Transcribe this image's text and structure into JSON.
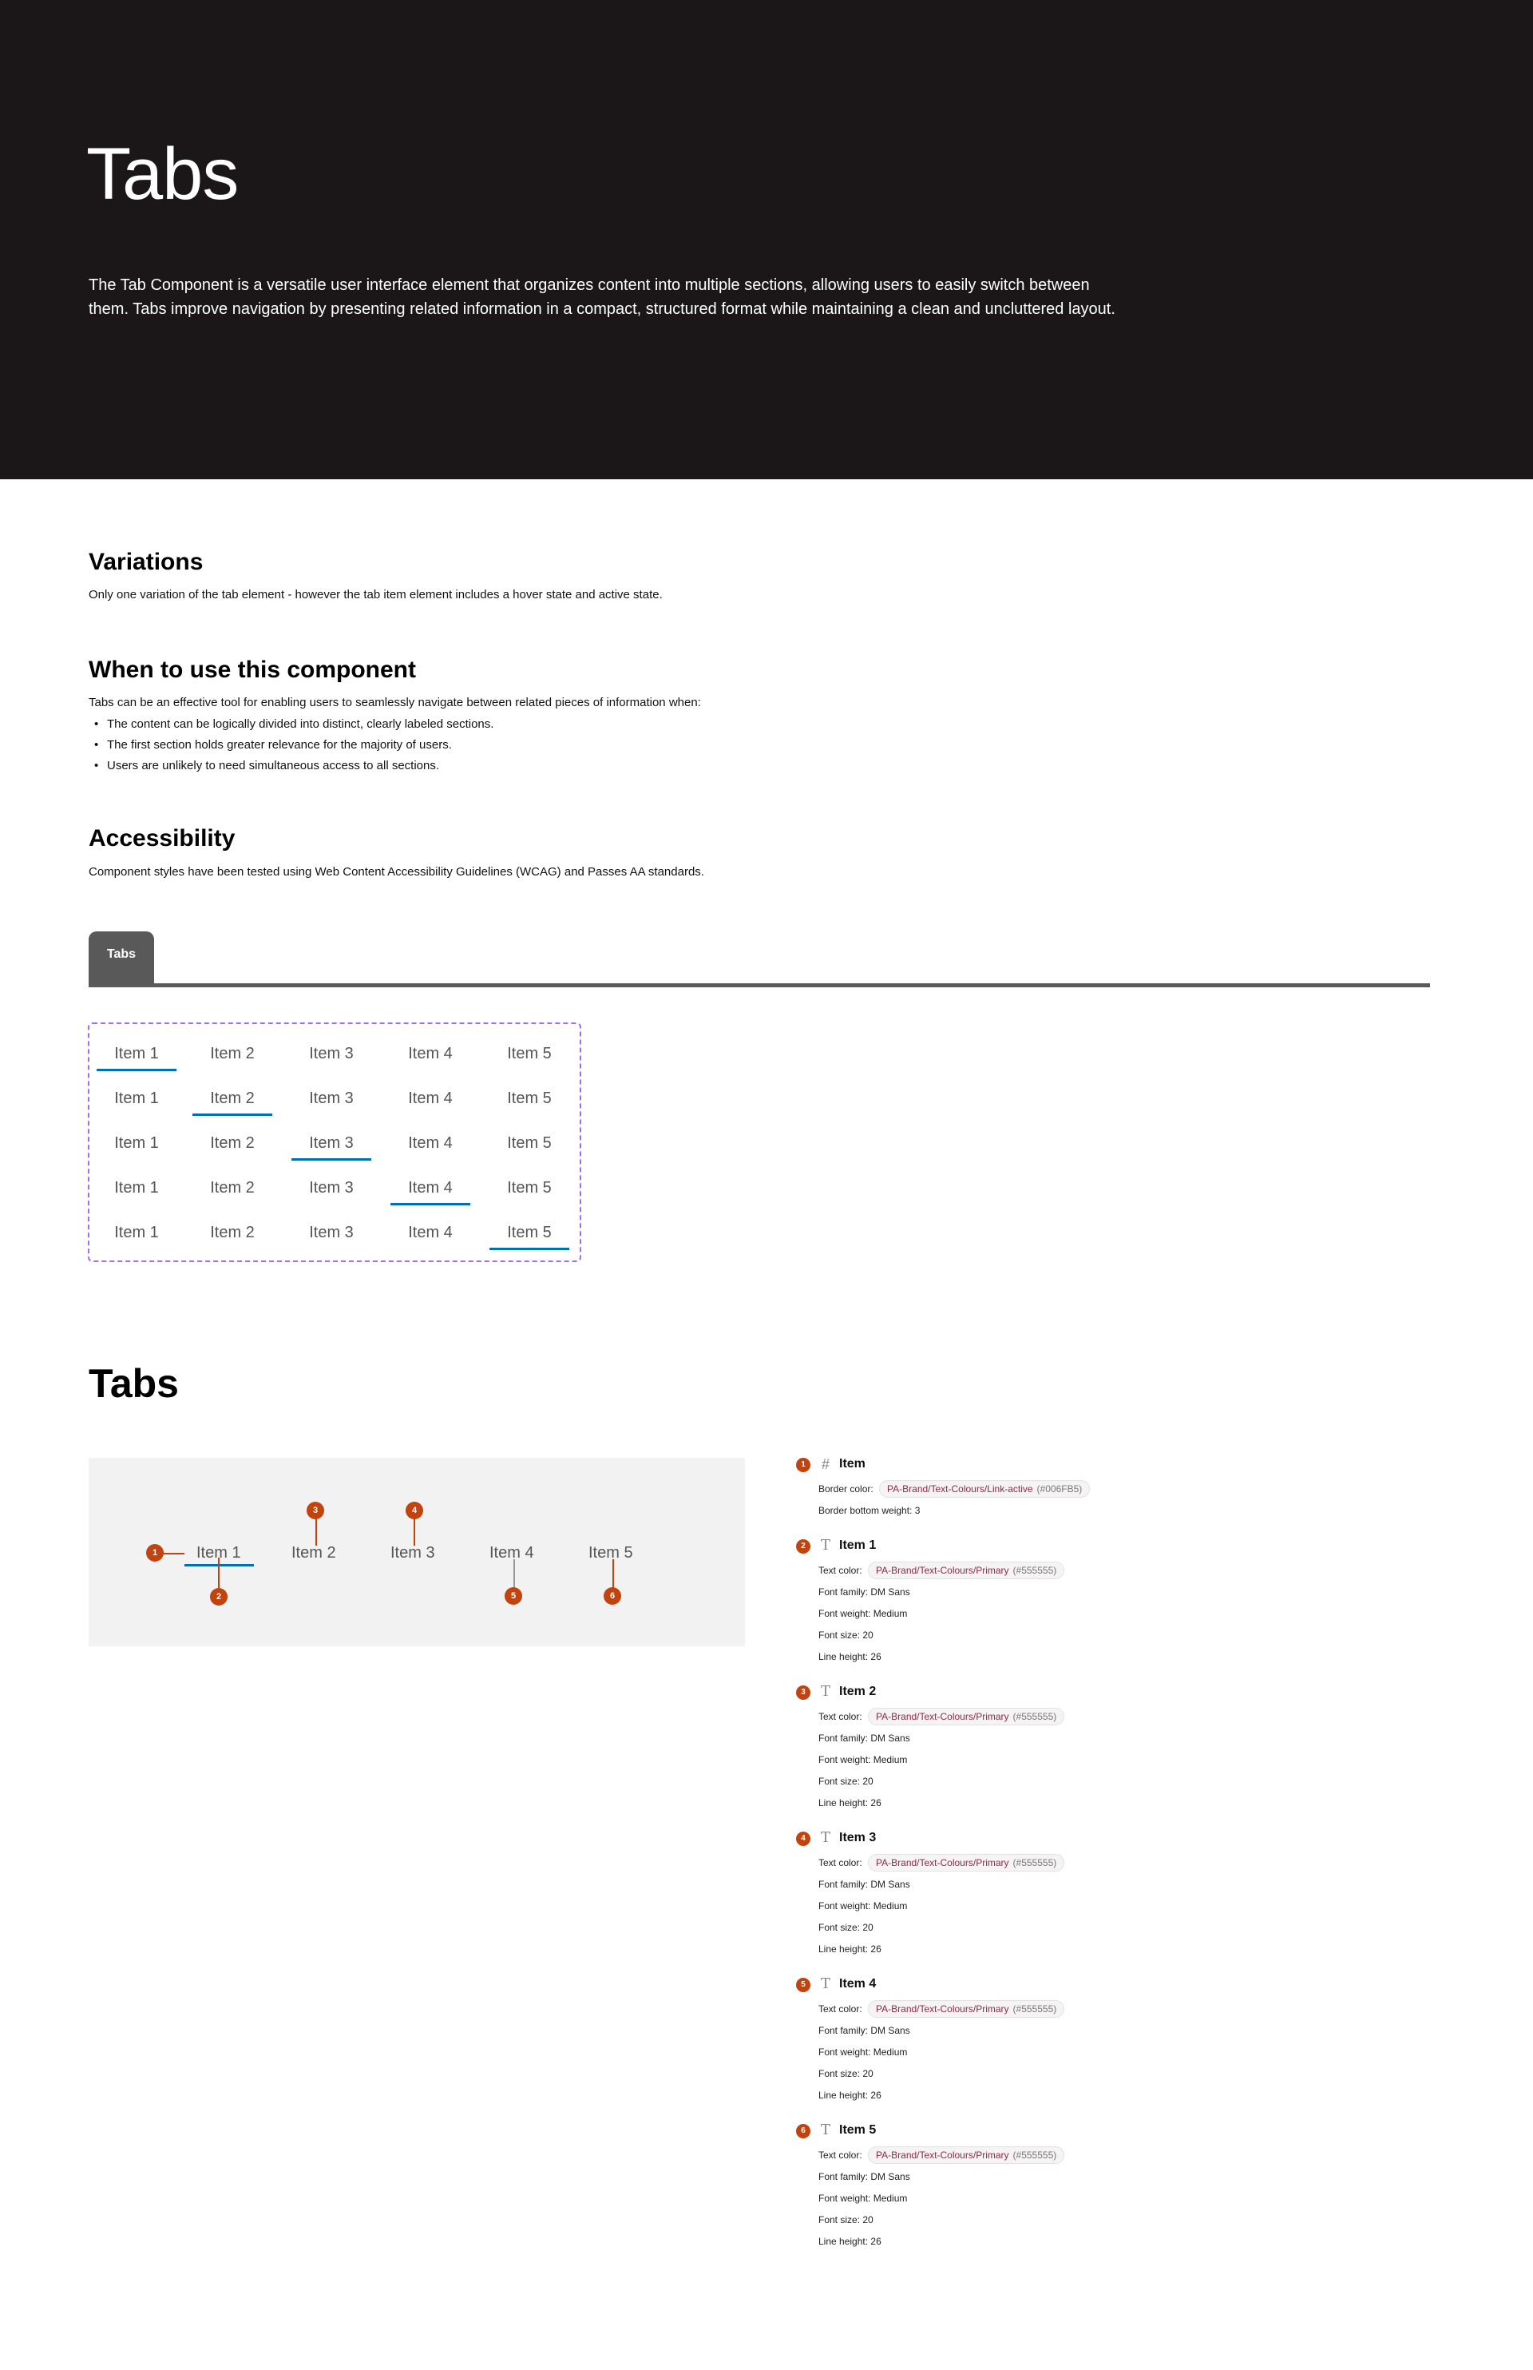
{
  "hero": {
    "title": "Tabs",
    "description": "The Tab Component is a versatile user interface element that organizes content into multiple sections, allowing users to easily switch between them. Tabs improve navigation by presenting related information in a compact, structured format while maintaining a clean and uncluttered layout."
  },
  "variations": {
    "heading": "Variations",
    "text": "Only one variation of the tab element - however the tab item element includes a hover state and active state."
  },
  "when_to_use": {
    "heading": "When to use this component",
    "intro": "Tabs can be an effective tool for enabling users to seamlessly navigate between related pieces of information when:",
    "bullets": [
      "The content can be logically divided into distinct, clearly labeled sections.",
      "The first section holds greater relevance for the majority of users.",
      "Users are unlikely to need simultaneous access to all sections."
    ]
  },
  "accessibility": {
    "heading": "Accessibility",
    "text": "Component styles have been tested using Web Content Accessibility Guidelines (WCAG) and Passes AA standards."
  },
  "tab_header": {
    "label": "Tabs"
  },
  "variation_grid": {
    "items": [
      "Item 1",
      "Item 2",
      "Item 3",
      "Item 4",
      "Item 5"
    ],
    "rows_active_index": [
      0,
      1,
      2,
      3,
      4
    ]
  },
  "anatomy": {
    "title": "Tabs",
    "items": [
      "Item 1",
      "Item 2",
      "Item 3",
      "Item 4",
      "Item 5"
    ],
    "markers": [
      "1",
      "2",
      "3",
      "4",
      "5",
      "6"
    ]
  },
  "colors": {
    "hero_bg": "#1b1718",
    "active_border": "#006FB5",
    "text_primary": "#555555",
    "marker": "#c1440e",
    "tab_header": "#595959",
    "dashed_border": "#a06cf0"
  },
  "spec": [
    {
      "num": "1",
      "icon": "frame-icon",
      "title": "Item",
      "lines": [
        {
          "label": "Border color:",
          "token": "PA-Brand/Text-Colours/Link-active",
          "hex": "(#006FB5)"
        },
        {
          "label": "Border bottom weight:",
          "value": "3"
        }
      ]
    },
    {
      "num": "2",
      "icon": "text-icon",
      "title": "Item 1",
      "lines": [
        {
          "label": "Text color:",
          "token": "PA-Brand/Text-Colours/Primary",
          "hex": "(#555555)"
        },
        {
          "label": "Font family:",
          "value": "DM Sans"
        },
        {
          "label": "Font weight:",
          "value": "Medium"
        },
        {
          "label": "Font size:",
          "value": "20"
        },
        {
          "label": "Line height:",
          "value": "26"
        }
      ]
    },
    {
      "num": "3",
      "icon": "text-icon",
      "title": "Item 2",
      "lines": [
        {
          "label": "Text color:",
          "token": "PA-Brand/Text-Colours/Primary",
          "hex": "(#555555)"
        },
        {
          "label": "Font family:",
          "value": "DM Sans"
        },
        {
          "label": "Font weight:",
          "value": "Medium"
        },
        {
          "label": "Font size:",
          "value": "20"
        },
        {
          "label": "Line height:",
          "value": "26"
        }
      ]
    },
    {
      "num": "4",
      "icon": "text-icon",
      "title": "Item 3",
      "lines": [
        {
          "label": "Text color:",
          "token": "PA-Brand/Text-Colours/Primary",
          "hex": "(#555555)"
        },
        {
          "label": "Font family:",
          "value": "DM Sans"
        },
        {
          "label": "Font weight:",
          "value": "Medium"
        },
        {
          "label": "Font size:",
          "value": "20"
        },
        {
          "label": "Line height:",
          "value": "26"
        }
      ]
    },
    {
      "num": "5",
      "icon": "text-icon",
      "title": "Item 4",
      "lines": [
        {
          "label": "Text color:",
          "token": "PA-Brand/Text-Colours/Primary",
          "hex": "(#555555)"
        },
        {
          "label": "Font family:",
          "value": "DM Sans"
        },
        {
          "label": "Font weight:",
          "value": "Medium"
        },
        {
          "label": "Font size:",
          "value": "20"
        },
        {
          "label": "Line height:",
          "value": "26"
        }
      ]
    },
    {
      "num": "6",
      "icon": "text-icon",
      "title": "Item 5",
      "lines": [
        {
          "label": "Text color:",
          "token": "PA-Brand/Text-Colours/Primary",
          "hex": "(#555555)"
        },
        {
          "label": "Font family:",
          "value": "DM Sans"
        },
        {
          "label": "Font weight:",
          "value": "Medium"
        },
        {
          "label": "Font size:",
          "value": "20"
        },
        {
          "label": "Line height:",
          "value": "26"
        }
      ]
    }
  ]
}
